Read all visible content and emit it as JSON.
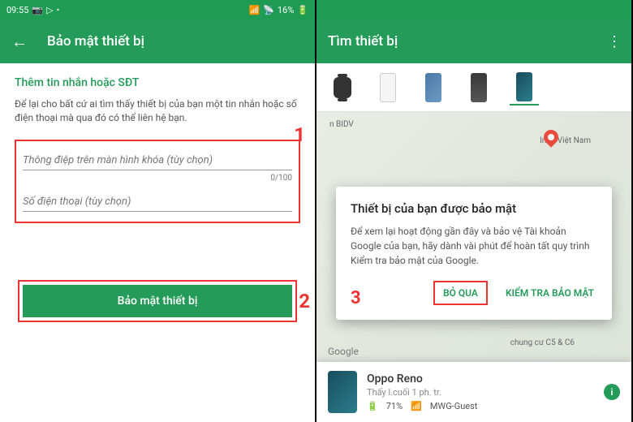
{
  "screen1": {
    "status": {
      "time": "09:55",
      "battery": "16%"
    },
    "header": {
      "title": "Bảo mật thiết bị"
    },
    "section_title": "Thêm tin nhắn hoặc SĐT",
    "desc": "Để lại cho bất cứ ai tìm thấy thiết bị của bạn một tin nhắn hoặc số điện thoại mà qua đó có thể liên hệ bạn.",
    "message_placeholder": "Thông điệp trên màn hình khóa (tùy chọn)",
    "counter": "0/100",
    "phone_placeholder": "Số điện thoại (tùy chọn)",
    "secure_btn": "Bảo mật thiết bị",
    "annotations": {
      "n1": "1",
      "n2": "2"
    }
  },
  "screen2": {
    "header": {
      "title": "Tìm thiết bị"
    },
    "map": {
      "label_intel": "Intel Việt Nam",
      "label_bidv": "n BIDV",
      "label_chungcu": "chung cư C5 & C6",
      "google": "Google"
    },
    "dialog": {
      "title": "Thiết bị của bạn được bảo mật",
      "text": "Để xem lại hoạt động gần đây và bảo vệ Tài khoản Google của bạn, hãy dành vài phút để hoàn tất quy trình Kiểm tra bảo mật của Google.",
      "skip": "BỎ QUA",
      "check": "KIỂM TRA BẢO MẬT",
      "annotation": "3"
    },
    "card": {
      "name": "Oppo Reno",
      "sub": "Thấy l.cuối 1 ph. tr.",
      "battery": "71%",
      "wifi": "MWG-Guest",
      "badge": "i"
    }
  }
}
